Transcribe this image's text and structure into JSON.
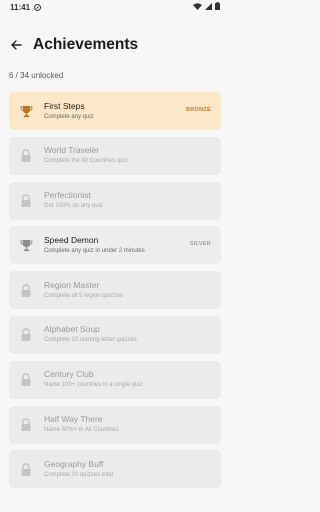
{
  "status_bar": {
    "time": "11:41"
  },
  "header": {
    "title": "Achievements"
  },
  "summary": {
    "text": "6 / 34 unlocked"
  },
  "colors": {
    "bronze_bg": "#fde7c9",
    "bronze_accent": "#c07a22",
    "silver_accent": "#9c9c9c",
    "locked_bg": "#ebebeb"
  },
  "achievements": [
    {
      "name": "First Steps",
      "desc": "Complete any quiz",
      "badge": "BRONZE",
      "icon": "trophy-icon"
    },
    {
      "name": "World Traveler",
      "desc": "Complete the All Countries quiz",
      "badge": "",
      "icon": "lock-icon"
    },
    {
      "name": "Perfectionist",
      "desc": "Get 100% on any quiz",
      "badge": "",
      "icon": "lock-icon"
    },
    {
      "name": "Speed Demon",
      "desc": "Complete any quiz in under 2 minutes",
      "badge": "SILVER",
      "icon": "trophy-icon"
    },
    {
      "name": "Region Master",
      "desc": "Complete all 5 region quizzes",
      "badge": "",
      "icon": "lock-icon"
    },
    {
      "name": "Alphabet Soup",
      "desc": "Complete 10 starting-letter quizzes",
      "badge": "",
      "icon": "lock-icon"
    },
    {
      "name": "Century Club",
      "desc": "Name 100+ countries in a single quiz",
      "badge": "",
      "icon": "lock-icon"
    },
    {
      "name": "Half Way There",
      "desc": "Name 50%+ in All Countries",
      "badge": "",
      "icon": "lock-icon"
    },
    {
      "name": "Geography Buff",
      "desc": "Complete 20 quizzes total",
      "badge": "",
      "icon": "lock-icon"
    }
  ]
}
